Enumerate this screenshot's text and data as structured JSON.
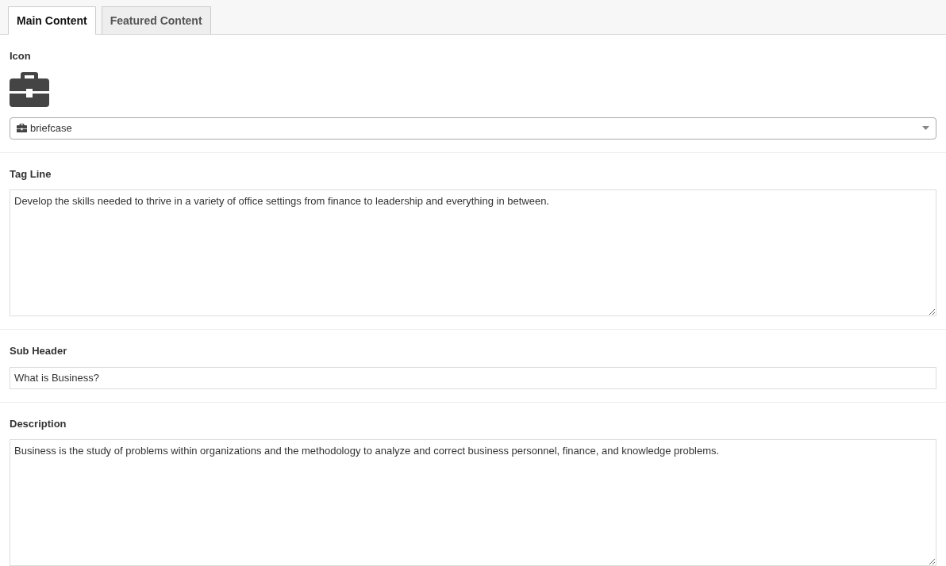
{
  "tabs": [
    {
      "label": "Main Content",
      "selected": true
    },
    {
      "label": "Featured Content",
      "selected": false
    }
  ],
  "fields": [
    {
      "kind": "icon-select",
      "label": "Icon",
      "value": "briefcase"
    },
    {
      "kind": "textarea",
      "label": "Tag Line",
      "value": "Develop the skills needed to thrive in a variety of office settings from finance to leadership and everything in between."
    },
    {
      "kind": "input",
      "label": "Sub Header",
      "value": "What is Business?"
    },
    {
      "kind": "textarea",
      "label": "Description",
      "value": "Business is the study of problems within organizations and the methodology to analyze and correct business personnel, finance, and knowledge problems."
    }
  ]
}
